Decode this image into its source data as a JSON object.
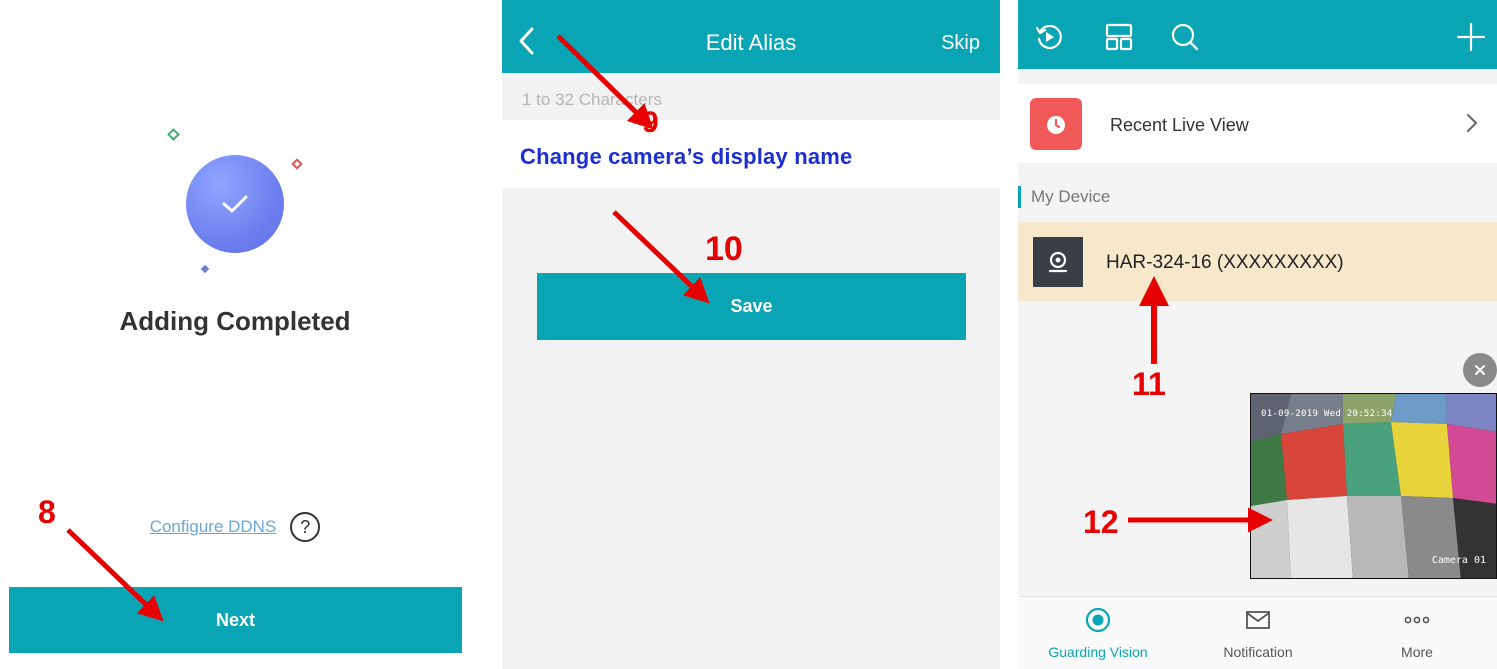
{
  "panel1": {
    "title": "Adding Completed",
    "configure_ddns": "Configure DDNS",
    "help_symbol": "?",
    "next_label": "Next",
    "colors": {
      "accent": "#0aa5b5",
      "circle": "#6e80f0",
      "diamond_green": "#3bb36a",
      "diamond_red": "#e05050",
      "diamond_blue": "#6e80d0"
    }
  },
  "panel2": {
    "title": "Edit Alias",
    "skip_label": "Skip",
    "hint": "1 to 32 Characters",
    "save_label": "Save"
  },
  "panel3": {
    "recent_live_view": "Recent Live View",
    "section_title": "My Device",
    "device_name": "HAR-324-16 (XXXXXXXXX)",
    "preview": {
      "osd_time": "01-09-2019 Wed 20:52:34",
      "osd_camera": "Camera 01"
    },
    "nav": [
      {
        "label": "Guarding Vision",
        "icon": "target-icon",
        "active": true
      },
      {
        "label": "Notification",
        "icon": "envelope-icon",
        "active": false
      },
      {
        "label": "More",
        "icon": "more-dots-icon",
        "active": false
      }
    ],
    "topbar_icons": [
      "playback-icon",
      "layout-icon",
      "search-icon",
      "add-icon"
    ],
    "colors": {
      "active_nav": "#0aa5b5",
      "device_highlight": "#f7e8cc",
      "recent_icon": "#f25a5a"
    }
  },
  "annotations": {
    "step8": "8",
    "step9": "9",
    "step9_text": "Change camera’s display name",
    "step10": "10",
    "step11": "11",
    "step12": "12",
    "arrow_color": "#e60000"
  }
}
